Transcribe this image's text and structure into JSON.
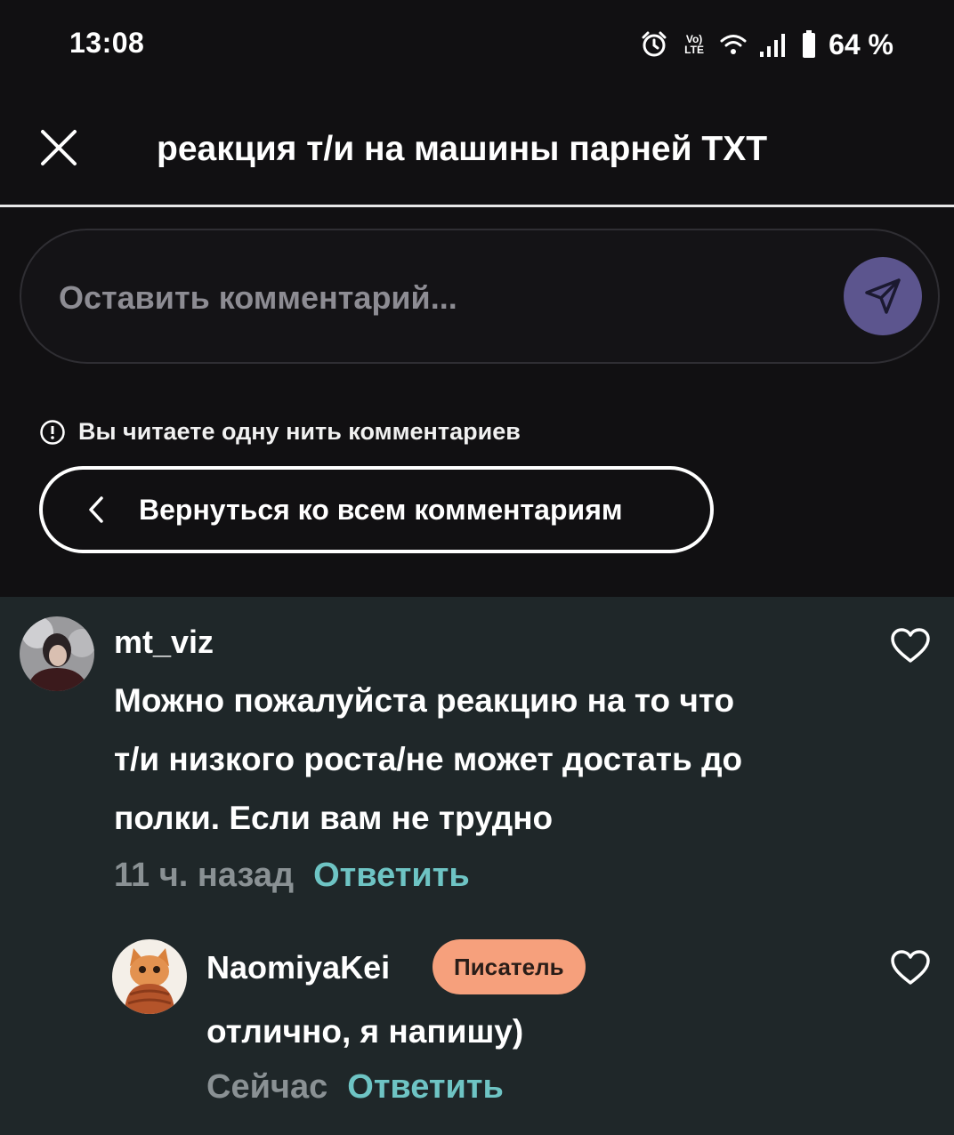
{
  "status_bar": {
    "time": "13:08",
    "volte_top": "Vo)",
    "volte_bottom": "LTE",
    "battery": "64 %"
  },
  "header": {
    "title": "реакция т/и на машины парней TXT"
  },
  "comment_input": {
    "placeholder": "Оставить комментарий..."
  },
  "thread": {
    "notice": "Вы читаете одну нить комментариев",
    "back_label": "Вернуться ко всем комментариям"
  },
  "comments": [
    {
      "username": "mt_viz",
      "lines": [
        "Можно пожалуйста реакцию на то что",
        "т/и низкого роста/не может достать до",
        "полки. Если вам не трудно"
      ],
      "time": "11 ч. назад",
      "reply": "Ответить"
    },
    {
      "username": "NaomiyaKei",
      "badge": "Писатель",
      "lines": [
        "отлично, я напишу)"
      ],
      "time": "Сейчас",
      "reply": "Ответить"
    }
  ],
  "colors": {
    "background": "#111012",
    "comments_bg": "#1f2729",
    "send_button": "#5c558e",
    "reply_link": "#6ec4c4",
    "badge": "#f6a07c"
  },
  "icons": [
    "alarm-icon",
    "wifi-icon",
    "signal-icon",
    "battery-icon",
    "close-icon",
    "send-icon",
    "info-icon",
    "chevron-left-icon",
    "heart-icon"
  ]
}
